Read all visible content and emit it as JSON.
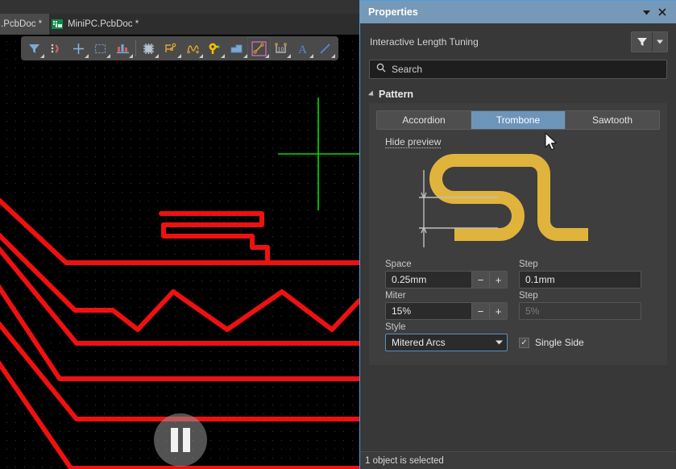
{
  "editor": {
    "tabs": [
      {
        "label": ".PcbDoc *",
        "active": true,
        "icon": "document-icon"
      },
      {
        "label": "MiniPC.PcbDoc *",
        "active": false,
        "icon": "pcb-document-icon"
      }
    ],
    "toolbar_items": [
      {
        "name": "filter-tool-icon"
      },
      {
        "name": "magnet-snap-icon"
      },
      {
        "name": "crosshair-placement-icon"
      },
      {
        "name": "selection-rectangle-icon"
      },
      {
        "name": "layer-stack-icon"
      },
      {
        "name": "component-chip-icon"
      },
      {
        "name": "route-net-icon"
      },
      {
        "name": "length-tuning-icon"
      },
      {
        "name": "via-pad-icon"
      },
      {
        "name": "polygon-pour-icon"
      },
      {
        "name": "line-measure-icon"
      },
      {
        "name": "dimension-10-icon"
      },
      {
        "name": "text-string-icon"
      },
      {
        "name": "line-draw-icon"
      }
    ],
    "overlay": {
      "name": "pause-button",
      "glyph": "pause"
    },
    "colors": {
      "canvas_background": "#000000",
      "trace_red": "#ee1111",
      "cursor_green": "#00dd00",
      "grid_dot": "#3a3a3a"
    }
  },
  "panel": {
    "title": "Properties",
    "collapse_icon": "chevron-down-icon",
    "close_icon": "close-icon",
    "object_name": "Interactive Length Tuning",
    "filter_icon": "funnel-filter-icon",
    "filter_dropdown_icon": "chevron-down-icon",
    "search": {
      "placeholder": "Search",
      "value": "Search",
      "icon": "search-icon"
    },
    "section": {
      "label": "Pattern",
      "expanded": true
    },
    "pattern_tabs": [
      {
        "label": "Accordion",
        "active": false
      },
      {
        "label": "Trombone",
        "active": true
      },
      {
        "label": "Sawtooth",
        "active": false
      }
    ],
    "preview": {
      "toggle_label": "Hide preview",
      "visible": true,
      "trace_color": "#e0b43c",
      "dimension_color": "#cfcfcf"
    },
    "fields": {
      "space": {
        "label": "Space",
        "value": "0.25mm",
        "minus": "−",
        "plus": "+"
      },
      "space_step": {
        "label": "Step",
        "value": "0.1mm"
      },
      "miter": {
        "label": "Miter",
        "value": "15%",
        "minus": "−",
        "plus": "+"
      },
      "miter_step": {
        "label": "Step",
        "value": "5%",
        "disabled": true
      },
      "style": {
        "label": "Style",
        "value": "Mitered Arcs",
        "arrow_icon": "chevron-down-icon"
      },
      "single_side": {
        "label": "Single Side",
        "checked": true,
        "check_glyph": "✓"
      }
    },
    "status": "1 object is selected",
    "colors": {
      "title_bar": "#7699b8",
      "panel_background": "#383838",
      "accent_blue": "#4a9fe0",
      "active_tab": "#6d95ba"
    }
  }
}
